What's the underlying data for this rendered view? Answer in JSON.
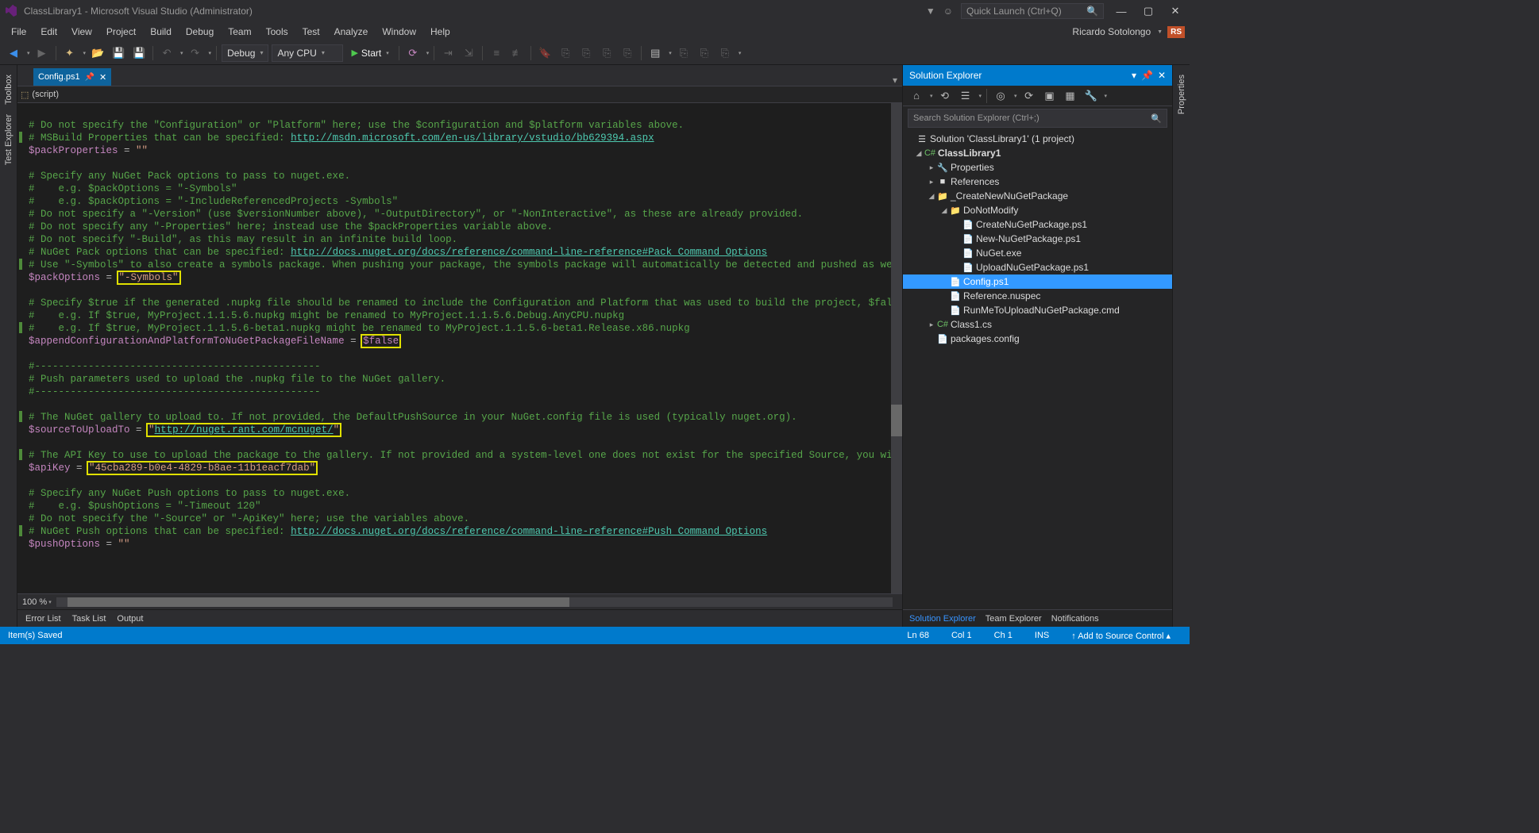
{
  "titlebar": {
    "title": "ClassLibrary1 - Microsoft Visual Studio  (Administrator)",
    "quick_launch_placeholder": "Quick Launch (Ctrl+Q)"
  },
  "user": {
    "name": "Ricardo Sotolongo",
    "initials": "RS"
  },
  "menus": [
    "File",
    "Edit",
    "View",
    "Project",
    "Build",
    "Debug",
    "Team",
    "Tools",
    "Test",
    "Analyze",
    "Window",
    "Help"
  ],
  "toolbar": {
    "config": "Debug",
    "platform": "Any CPU",
    "start": "Start"
  },
  "tab": {
    "name": "Config.ps1"
  },
  "script_dropdown": "(script)",
  "zoom": "100 %",
  "bottom_tabs": [
    "Error List",
    "Task List",
    "Output"
  ],
  "solution_panel": {
    "title": "Solution Explorer",
    "search_placeholder": "Search Solution Explorer (Ctrl+;)",
    "tree": {
      "sln": "Solution 'ClassLibrary1' (1 project)",
      "proj": "ClassLibrary1",
      "properties": "Properties",
      "references": "References",
      "folder1": "_CreateNewNuGetPackage",
      "folder2": "DoNotModify",
      "f1": "CreateNuGetPackage.ps1",
      "f2": "New-NuGetPackage.ps1",
      "f3": "NuGet.exe",
      "f4": "UploadNuGetPackage.ps1",
      "f5": "Config.ps1",
      "f6": "Reference.nuspec",
      "f7": "RunMeToUploadNuGetPackage.cmd",
      "class1": "Class1.cs",
      "pkgcfg": "packages.config"
    },
    "tabs": [
      "Solution Explorer",
      "Team Explorer",
      "Notifications"
    ]
  },
  "rightrail": "Properties",
  "leftrail": [
    "Toolbox",
    "Test Explorer"
  ],
  "status": {
    "left": "Item(s) Saved",
    "ln": "Ln 68",
    "col": "Col 1",
    "ch": "Ch 1",
    "ins": "INS",
    "src": "Add to Source Control"
  },
  "code": {
    "l1": "# Do not specify the \"Configuration\" or \"Platform\" here; use the $configuration and $platform variables above.",
    "l2a": "# MSBuild Properties that can be specified: ",
    "l2b": "http://msdn.microsoft.com/en-us/library/vstudio/bb629394.aspx",
    "l3v": "$packProperties",
    "l3o": " = ",
    "l3s": "\"\"",
    "l5": "# Specify any NuGet Pack options to pass to nuget.exe.",
    "l6": "#    e.g. $packOptions = \"-Symbols\"",
    "l7": "#    e.g. $packOptions = \"-IncludeReferencedProjects -Symbols\"",
    "l8": "# Do not specify a \"-Version\" (use $versionNumber above), \"-OutputDirectory\", or \"-NonInteractive\", as these are already provided.",
    "l9": "# Do not specify any \"-Properties\" here; instead use the $packProperties variable above.",
    "l10": "# Do not specify \"-Build\", as this may result in an infinite build loop.",
    "l11a": "# NuGet Pack options that can be specified: ",
    "l11b": "http://docs.nuget.org/docs/reference/command-line-reference#Pack_Command_Options",
    "l12": "# Use \"-Symbols\" to also create a symbols package. When pushing your package, the symbols package will automatically be detected and pushed as well",
    "l13v": "$packOptions",
    "l13o": " = ",
    "l13s": "\"-Symbols\"",
    "l15": "# Specify $true if the generated .nupkg file should be renamed to include the Configuration and Platform that was used to build the project, $false",
    "l16": "#    e.g. If $true, MyProject.1.1.5.6.nupkg might be renamed to MyProject.1.1.5.6.Debug.AnyCPU.nupkg",
    "l17": "#    e.g. If $true, MyProject.1.1.5.6-beta1.nupkg might be renamed to MyProject.1.1.5.6-beta1.Release.x86.nupkg",
    "l18v": "$appendConfigurationAndPlatformToNuGetPackageFileName",
    "l18o": " = ",
    "l18k": "$false",
    "l20": "#------------------------------------------------",
    "l21": "# Push parameters used to upload the .nupkg file to the NuGet gallery.",
    "l22": "#------------------------------------------------",
    "l24": "# The NuGet gallery to upload to. If not provided, the DefaultPushSource in your NuGet.config file is used (typically nuget.org).",
    "l25v": "$sourceToUploadTo",
    "l25o": " = ",
    "l25q": "\"",
    "l25u": "http://nuget.rant.com/mcnuget/",
    "l25q2": "\"",
    "l27": "# The API Key to use to upload the package to the gallery. If not provided and a system-level one does not exist for the specified Source, you will",
    "l28v": "$apiKey",
    "l28o": " = ",
    "l28s": "\"45cba289-b0e4-4829-b8ae-11b1eacf7dab\"",
    "l30": "# Specify any NuGet Push options to pass to nuget.exe.",
    "l31": "#    e.g. $pushOptions = \"-Timeout 120\"",
    "l32": "# Do not specify the \"-Source\" or \"-ApiKey\" here; use the variables above.",
    "l33a": "# NuGet Push options that can be specified: ",
    "l33b": "http://docs.nuget.org/docs/reference/command-line-reference#Push_Command_Options",
    "l34v": "$pushOptions",
    "l34o": " = ",
    "l34s": "\"\""
  }
}
